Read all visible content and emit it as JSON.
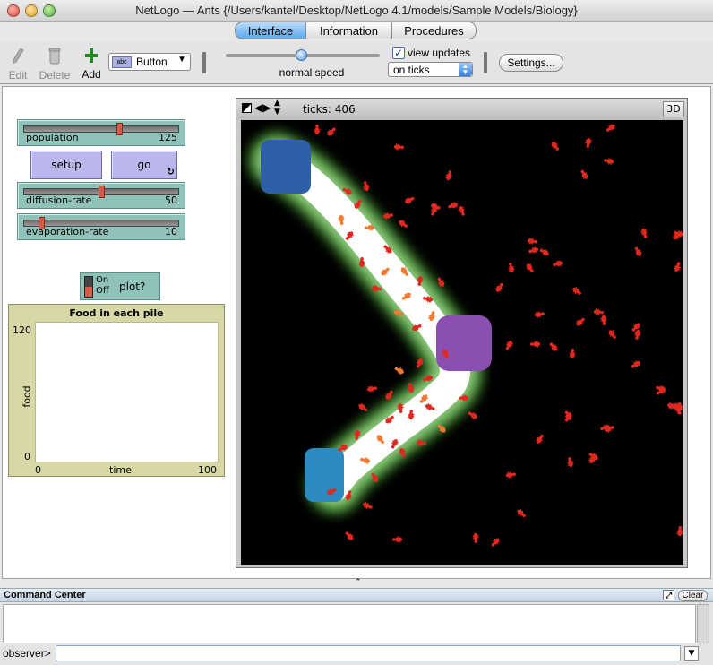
{
  "window": {
    "title": "NetLogo — Ants {/Users/kantel/Desktop/NetLogo 4.1/models/Sample Models/Biology}"
  },
  "tabs": [
    {
      "label": "Interface",
      "active": true
    },
    {
      "label": "Information",
      "active": false
    },
    {
      "label": "Procedures",
      "active": false
    }
  ],
  "toolbar": {
    "edit_label": "Edit",
    "delete_label": "Delete",
    "add_label": "Add",
    "widget_type": "Button",
    "speed_label": "normal speed",
    "view_updates_label": "view updates",
    "view_updates_checked": true,
    "update_mode": "on ticks",
    "settings_label": "Settings..."
  },
  "widgets": {
    "population": {
      "label": "population",
      "value": "125",
      "fraction": 0.62
    },
    "setup_label": "setup",
    "go_label": "go",
    "diffusion_rate": {
      "label": "diffusion-rate",
      "value": "50",
      "fraction": 0.5
    },
    "evaporation_rate": {
      "label": "evaporation-rate",
      "value": "10",
      "fraction": 0.1
    },
    "plot_switch": {
      "on_label": "On",
      "off_label": "Off",
      "label": "plot?"
    },
    "plot": {
      "title": "Food in each pile",
      "ylabel": "food",
      "xlabel": "time",
      "ymax_label": "120",
      "ymin_label": "0",
      "xmin_label": "0",
      "xmax_label": "100"
    }
  },
  "view": {
    "ticks_label": "ticks: 406",
    "three_d_label": "3D",
    "colors": {
      "background": "#000000",
      "pheromone": "#ffffff",
      "pheromone_edge": "#3c8a2a",
      "nest_food_pile_1": "#2f5fa8",
      "food_pile_2": "#8a4fb0",
      "food_pile_3": "#2c8ac0",
      "ant": "#e0281e",
      "ant_with_food": "#f07a30"
    }
  },
  "command_center": {
    "title": "Command Center",
    "clear_label": "Clear",
    "prompt_label": "observer>",
    "input_value": ""
  }
}
